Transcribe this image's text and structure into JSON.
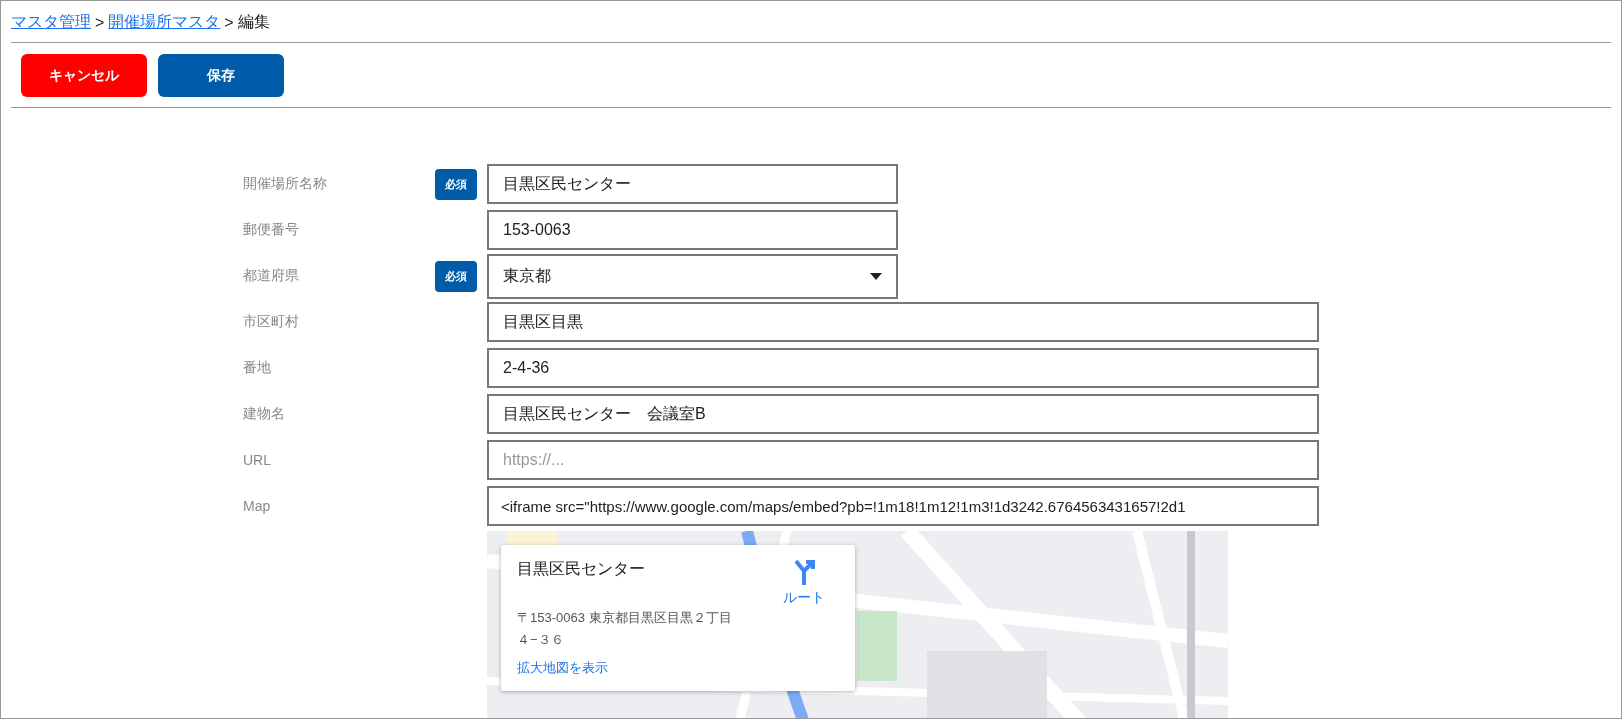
{
  "breadcrumb": {
    "separator": ">",
    "items": [
      {
        "label": "マスタ管理",
        "kind": "link"
      },
      {
        "label": "開催場所マスタ",
        "kind": "link"
      },
      {
        "label": "編集",
        "kind": "current"
      }
    ]
  },
  "buttons": [
    {
      "label": "キャンセル",
      "kind": "danger"
    },
    {
      "label": "保存",
      "kind": "primary"
    }
  ],
  "fields": [
    {
      "label": "開催場所名称",
      "badge": "必須",
      "kind": "text",
      "value": "目黒区民センター"
    },
    {
      "label": "郵便番号",
      "kind": "text",
      "value": "153-0063"
    },
    {
      "label": "都道府県",
      "badge": "必須",
      "kind": "select",
      "value": "東京都"
    },
    {
      "label": "市区町村",
      "kind": "text",
      "value": "目黒区目黒"
    },
    {
      "label": "番地",
      "kind": "text",
      "value": "2-4-36"
    },
    {
      "label": "建物名",
      "kind": "text",
      "value": "目黒区民センター　会議室B"
    },
    {
      "label": "URL",
      "kind": "text",
      "placeholder": "https://..."
    },
    {
      "label": "Map",
      "kind": "text",
      "value": "<iframe src=\"https://www.google.com/maps/embed?pb=!1m18!1m12!1m3!1d3242.6764563431657!2d1"
    }
  ],
  "map": {
    "kind": "picture",
    "card": {
      "title": "目黒区民センター",
      "address_lines": [
        "〒153-0063 東京都目黒区目黒２丁目",
        "４−３６"
      ],
      "directions": "ルート",
      "link": "拡大地図を表示"
    }
  }
}
